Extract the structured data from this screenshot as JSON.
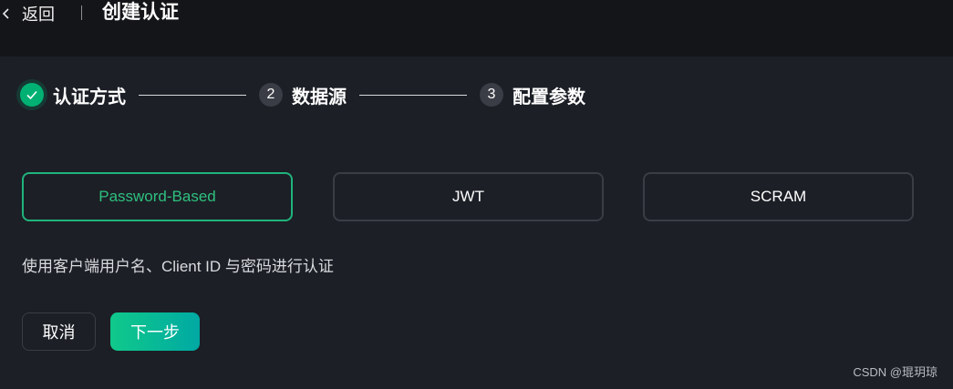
{
  "header": {
    "back_label": "返回",
    "title": "创建认证"
  },
  "steps": [
    {
      "index": "",
      "label": "认证方式",
      "status": "done"
    },
    {
      "index": "2",
      "label": "数据源",
      "status": "todo"
    },
    {
      "index": "3",
      "label": "配置参数",
      "status": "todo"
    }
  ],
  "auth_options": [
    {
      "label": "Password-Based",
      "selected": true
    },
    {
      "label": "JWT",
      "selected": false
    },
    {
      "label": "SCRAM",
      "selected": false
    }
  ],
  "description": "使用客户端用户名、Client ID 与密码进行认证",
  "actions": {
    "cancel_label": "取消",
    "next_label": "下一步"
  },
  "watermark": "CSDN @琨玥琼",
  "colors": {
    "accent": "#1fb47c",
    "background": "#1c1f26",
    "topbar": "#141518"
  }
}
